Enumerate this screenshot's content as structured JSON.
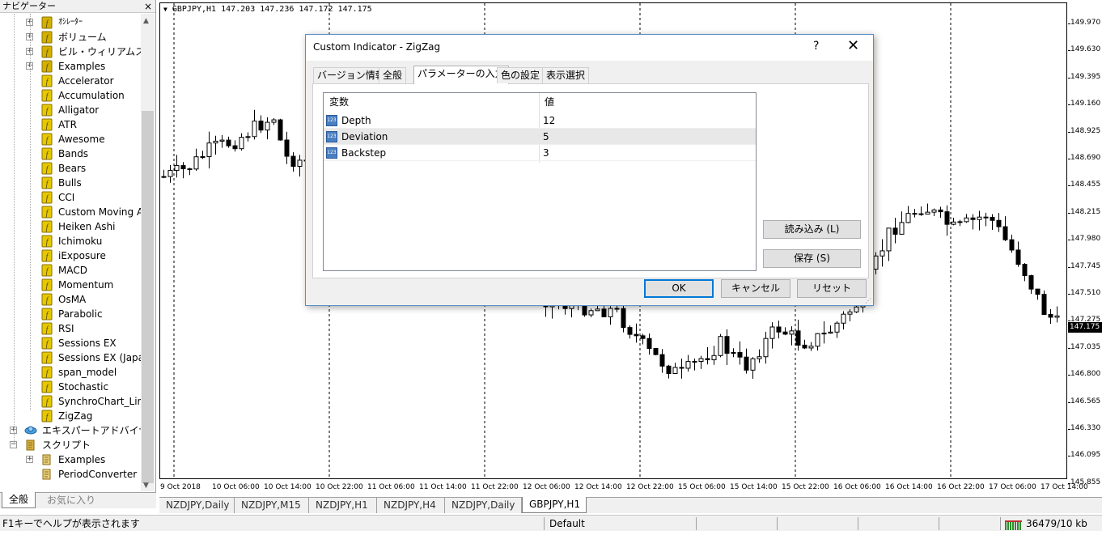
{
  "navigator": {
    "title": "ナビゲーター",
    "close_label": "×",
    "items": [
      {
        "label": "ｵｼﾚｰﾀｰ",
        "kind": "folder",
        "depth": 2,
        "expand": "+"
      },
      {
        "label": "ボリューム",
        "kind": "folder",
        "depth": 2,
        "expand": "+"
      },
      {
        "label": "ビル・ウィリアムス",
        "kind": "folder",
        "depth": 2,
        "expand": "+"
      },
      {
        "label": "Examples",
        "kind": "folder",
        "depth": 2,
        "expand": "+"
      },
      {
        "label": "Accelerator",
        "kind": "indicator",
        "depth": 2
      },
      {
        "label": "Accumulation",
        "kind": "indicator",
        "depth": 2
      },
      {
        "label": "Alligator",
        "kind": "indicator",
        "depth": 2
      },
      {
        "label": "ATR",
        "kind": "indicator",
        "depth": 2
      },
      {
        "label": "Awesome",
        "kind": "indicator",
        "depth": 2
      },
      {
        "label": "Bands",
        "kind": "indicator",
        "depth": 2
      },
      {
        "label": "Bears",
        "kind": "indicator",
        "depth": 2
      },
      {
        "label": "Bulls",
        "kind": "indicator",
        "depth": 2
      },
      {
        "label": "CCI",
        "kind": "indicator",
        "depth": 2
      },
      {
        "label": "Custom Moving Av",
        "kind": "indicator",
        "depth": 2
      },
      {
        "label": "Heiken Ashi",
        "kind": "indicator",
        "depth": 2
      },
      {
        "label": "Ichimoku",
        "kind": "indicator",
        "depth": 2
      },
      {
        "label": "iExposure",
        "kind": "indicator",
        "depth": 2
      },
      {
        "label": "MACD",
        "kind": "indicator",
        "depth": 2
      },
      {
        "label": "Momentum",
        "kind": "indicator",
        "depth": 2
      },
      {
        "label": "OsMA",
        "kind": "indicator",
        "depth": 2
      },
      {
        "label": "Parabolic",
        "kind": "indicator",
        "depth": 2
      },
      {
        "label": "RSI",
        "kind": "indicator",
        "depth": 2
      },
      {
        "label": "Sessions EX",
        "kind": "indicator",
        "depth": 2
      },
      {
        "label": "Sessions EX (Japane",
        "kind": "indicator",
        "depth": 2
      },
      {
        "label": "span_model",
        "kind": "indicator",
        "depth": 2
      },
      {
        "label": "Stochastic",
        "kind": "indicator",
        "depth": 2
      },
      {
        "label": "SynchroChart_Line",
        "kind": "indicator",
        "depth": 2
      },
      {
        "label": "ZigZag",
        "kind": "indicator",
        "depth": 2
      },
      {
        "label": "エキスパートアドバイザ",
        "kind": "expert",
        "depth": 1,
        "expand": "+"
      },
      {
        "label": "スクリプト",
        "kind": "script",
        "depth": 1,
        "expand": "−"
      },
      {
        "label": "Examples",
        "kind": "scriptitem",
        "depth": 2,
        "expand": "+"
      },
      {
        "label": "PeriodConverter",
        "kind": "scriptitem",
        "depth": 2
      }
    ],
    "tabs": [
      {
        "label": "全般",
        "active": true
      },
      {
        "label": "お気に入り",
        "active": false
      }
    ]
  },
  "chart": {
    "title": "GBPJPY,H1  147.203 147.236 147.172 147.175",
    "current_price": "147.175",
    "price_ticks": [
      "149.970",
      "149.630",
      "149.395",
      "149.160",
      "148.925",
      "148.690",
      "148.455",
      "148.215",
      "147.980",
      "147.745",
      "147.510",
      "147.275",
      "147.035",
      "146.800",
      "146.565",
      "146.330",
      "146.095",
      "145.855"
    ],
    "time_ticks": [
      "9 Oct 2018",
      "10 Oct 06:00",
      "10 Oct 14:00",
      "10 Oct 22:00",
      "11 Oct 06:00",
      "11 Oct 14:00",
      "11 Oct 22:00",
      "12 Oct 06:00",
      "12 Oct 14:00",
      "12 Oct 22:00",
      "15 Oct 06:00",
      "15 Oct 14:00",
      "15 Oct 22:00",
      "16 Oct 06:00",
      "16 Oct 14:00",
      "16 Oct 22:00",
      "17 Oct 06:00",
      "17 Oct 14:00"
    ],
    "colors": {
      "bull": "#ffffff",
      "bear": "#000000",
      "grid": "#000000"
    }
  },
  "symbol_tabs": [
    {
      "label": "NZDJPY,Daily",
      "active": false
    },
    {
      "label": "NZDJPY,M15",
      "active": false
    },
    {
      "label": "NZDJPY,H1",
      "active": false
    },
    {
      "label": "NZDJPY,H4",
      "active": false
    },
    {
      "label": "NZDJPY,Daily",
      "active": false
    },
    {
      "label": "GBPJPY,H1",
      "active": true
    }
  ],
  "status": {
    "help": "F1キーでヘルプが表示されます",
    "profile": "Default",
    "traffic": "36479/10 kb"
  },
  "dialog": {
    "title": "Custom Indicator - ZigZag",
    "help_label": "?",
    "close_label": "✕",
    "tabs": [
      {
        "label": "バージョン情報",
        "active": false
      },
      {
        "label": "全般",
        "active": false
      },
      {
        "label": "パラメーターの入力",
        "active": true
      },
      {
        "label": "色の設定",
        "active": false
      },
      {
        "label": "表示選択",
        "active": false
      }
    ],
    "grid": {
      "col_variable": "変数",
      "col_value": "値",
      "rows": [
        {
          "name": "Depth",
          "value": "12",
          "type_icon": "123"
        },
        {
          "name": "Deviation",
          "value": "5",
          "type_icon": "123"
        },
        {
          "name": "Backstep",
          "value": "3",
          "type_icon": "123"
        }
      ]
    },
    "load_label": "読み込み (L)",
    "save_label": "保存 (S)",
    "ok_label": "OK",
    "cancel_label": "キャンセル",
    "reset_label": "リセット"
  }
}
